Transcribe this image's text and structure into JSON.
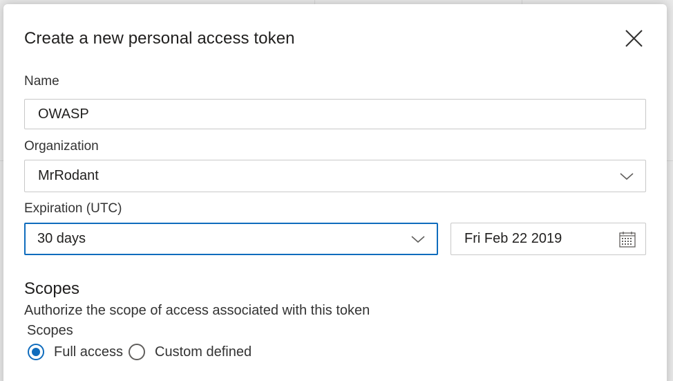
{
  "dialog": {
    "title": "Create a new personal access token"
  },
  "form": {
    "name": {
      "label": "Name",
      "value": "OWASP"
    },
    "organization": {
      "label": "Organization",
      "value": "MrRodant"
    },
    "expiration": {
      "label": "Expiration (UTC)",
      "duration": "30 days",
      "date": "Fri Feb 22 2019"
    }
  },
  "scopes": {
    "title": "Scopes",
    "description": "Authorize the scope of access associated with this token",
    "group_label": "Scopes",
    "options": [
      {
        "label": "Full access",
        "selected": true
      },
      {
        "label": "Custom defined",
        "selected": false
      }
    ]
  },
  "colors": {
    "accent": "#0f6cbd",
    "text": "#201f1e",
    "border": "#c8c8c8"
  }
}
